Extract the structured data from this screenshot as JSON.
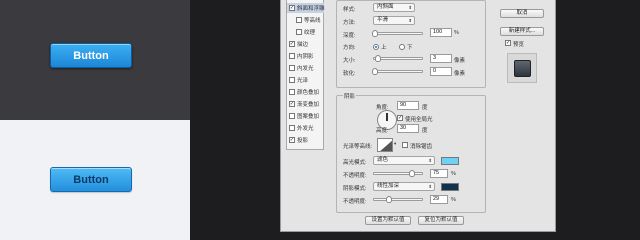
{
  "demo": {
    "button_label_dark": "Button",
    "button_label_light": "Button"
  },
  "styles": {
    "items": [
      {
        "label": "斜面和浮雕",
        "checked": true,
        "selected": true,
        "sub": false
      },
      {
        "label": "等高线",
        "checked": false,
        "selected": false,
        "sub": true
      },
      {
        "label": "纹理",
        "checked": false,
        "selected": false,
        "sub": true
      },
      {
        "label": "描边",
        "checked": true,
        "selected": false,
        "sub": false
      },
      {
        "label": "内阴影",
        "checked": false,
        "selected": false,
        "sub": false
      },
      {
        "label": "内发光",
        "checked": false,
        "selected": false,
        "sub": false
      },
      {
        "label": "光泽",
        "checked": false,
        "selected": false,
        "sub": false
      },
      {
        "label": "颜色叠加",
        "checked": false,
        "selected": false,
        "sub": false
      },
      {
        "label": "渐变叠加",
        "checked": true,
        "selected": false,
        "sub": false
      },
      {
        "label": "图案叠加",
        "checked": false,
        "selected": false,
        "sub": false
      },
      {
        "label": "外发光",
        "checked": false,
        "selected": false,
        "sub": false
      },
      {
        "label": "投影",
        "checked": true,
        "selected": false,
        "sub": false
      }
    ]
  },
  "structure": {
    "style_label": "样式:",
    "style_value": "内斜面",
    "method_label": "方法:",
    "method_value": "平滑",
    "depth_label": "深度:",
    "depth_value": "100",
    "depth_unit": "%",
    "direction_label": "方向:",
    "direction_up": "上",
    "direction_down": "下",
    "size_label": "大小:",
    "size_value": "3",
    "size_unit": "像素",
    "soften_label": "软化:",
    "soften_value": "0",
    "soften_unit": "像素"
  },
  "shading": {
    "title": "阴影",
    "angle_label": "角度:",
    "angle_value": "90",
    "angle_unit": "度",
    "global_light_label": "使用全局光",
    "altitude_label": "高度:",
    "altitude_value": "30",
    "altitude_unit": "度",
    "gloss_label": "光泽等高线:",
    "antialias_label": "消除锯齿",
    "highlight_label": "高光模式:",
    "highlight_value": "滤色",
    "highlight_color": "#6fd1f6",
    "opacity_label": "不透明度:",
    "highlight_opacity": "75",
    "opacity_unit": "%",
    "shadow_label": "阴影模式:",
    "shadow_value": "线性加深",
    "shadow_color": "#12314d",
    "shadow_opacity": "29"
  },
  "footer": {
    "default_label": "设置为默认值",
    "reset_label": "复位为默认值"
  },
  "side": {
    "cancel_label": "取消",
    "new_style_label": "新建样式...",
    "preview_label": "预览"
  }
}
